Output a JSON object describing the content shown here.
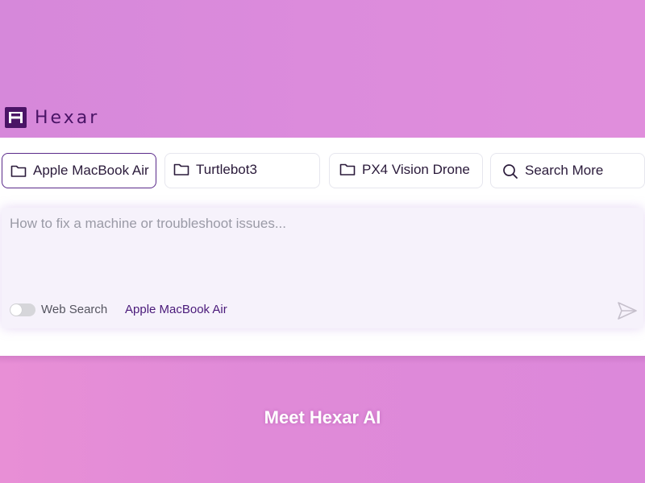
{
  "brand": {
    "name": "Hexar",
    "logo_letter": "H",
    "color": "#4a1466"
  },
  "chips": [
    {
      "label": "Apple MacBook Air",
      "icon": "folder-icon",
      "selected": true
    },
    {
      "label": "Turtlebot3",
      "icon": "folder-icon",
      "selected": false
    },
    {
      "label": "PX4 Vision Drone",
      "icon": "folder-icon",
      "selected": false
    },
    {
      "label": "Search More",
      "icon": "search-icon",
      "selected": false
    }
  ],
  "composer": {
    "placeholder": "How to fix a machine or troubleshoot issues...",
    "value": "",
    "web_search_label": "Web Search",
    "web_search_enabled": false,
    "context_label": "Apple MacBook Air",
    "send_icon": "send-icon"
  },
  "hero": {
    "headline": "Meet Hexar AI"
  },
  "colors": {
    "accent": "#5a2a8a",
    "background_top": "#d98ad9",
    "background_bottom": "#e08ad8"
  }
}
